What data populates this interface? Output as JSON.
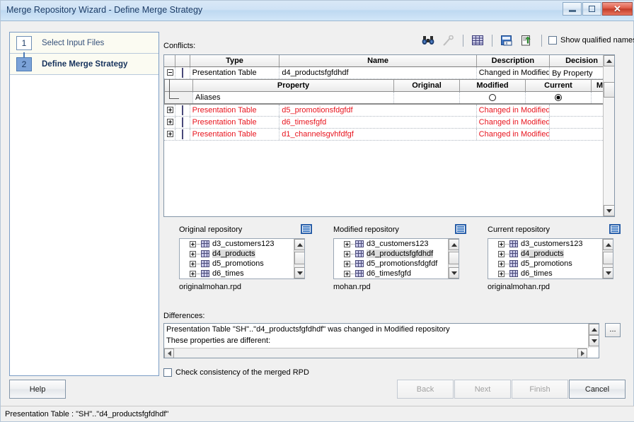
{
  "window": {
    "title": "Merge Repository Wizard - Define Merge Strategy",
    "minimize_label": "–",
    "restore_label": "□",
    "close_label": "✕"
  },
  "sidebar": {
    "steps": [
      {
        "num": "1",
        "label": "Select Input Files",
        "active": false
      },
      {
        "num": "2",
        "label": "Define Merge Strategy",
        "active": true
      }
    ]
  },
  "main": {
    "conflicts_label": "Conflicts:",
    "differences_label": "Differences:",
    "ellipsis_label": "..."
  },
  "toolbar": {
    "find_icon": "binoculars-icon",
    "wand_icon": "magic-wand-icon",
    "grid_icon": "grid-icon",
    "excel_icon": "export-excel-icon",
    "doc_icon": "import-document-icon",
    "show_qualified_names": "Show qualified names",
    "show_qualified_checked": false
  },
  "grid": {
    "headers": [
      "Type",
      "Name",
      "Description",
      "Decision"
    ],
    "rows": [
      {
        "expander": "minus",
        "type": "Presentation Table",
        "name": "d4_productsfgfdhdf",
        "description": "Changed in Modified",
        "decision": "By Property",
        "color": "black",
        "expanded": true
      },
      {
        "expander": "plus",
        "type": "Presentation Table",
        "name": "d5_promotionsfdgfdf",
        "description": "Changed in Modified",
        "decision": "",
        "color": "red",
        "expanded": false
      },
      {
        "expander": "plus",
        "type": "Presentation Table",
        "name": "d6_timesfgfd",
        "description": "Changed in Modified",
        "decision": "",
        "color": "red",
        "expanded": false
      },
      {
        "expander": "plus",
        "type": "Presentation Table",
        "name": "d1_channelsgvhfdfgf",
        "description": "Changed in Modified",
        "decision": "",
        "color": "red",
        "expanded": false
      }
    ],
    "subgrid": {
      "headers": [
        "Property",
        "Original",
        "Modified",
        "Current",
        "Merge Choices"
      ],
      "rows": [
        {
          "property": "Aliases",
          "original": "",
          "modified_selected": false,
          "current_selected": true,
          "merge_selected": false
        }
      ]
    }
  },
  "repositories": [
    {
      "title": "Original repository",
      "icon": "properties-icon",
      "file": "originalmohan.rpd",
      "nodes": [
        {
          "label": "d3_customers123",
          "selected": false
        },
        {
          "label": "d4_products",
          "selected": true
        },
        {
          "label": "d5_promotions",
          "selected": false
        },
        {
          "label": "d6_times",
          "selected": false
        }
      ]
    },
    {
      "title": "Modified repository",
      "icon": "properties-icon",
      "file": "mohan.rpd",
      "nodes": [
        {
          "label": "d3_customers123",
          "selected": false
        },
        {
          "label": "d4_productsfgfdhdf",
          "selected": true
        },
        {
          "label": "d5_promotionsfdgfdf",
          "selected": false
        },
        {
          "label": "d6_timesfgfd",
          "selected": false
        }
      ]
    },
    {
      "title": "Current repository",
      "icon": "properties-icon",
      "file": "originalmohan.rpd",
      "nodes": [
        {
          "label": "d3_customers123",
          "selected": false
        },
        {
          "label": "d4_products",
          "selected": true
        },
        {
          "label": "d5_promotions",
          "selected": false
        },
        {
          "label": "d6_times",
          "selected": false
        }
      ]
    }
  ],
  "differences": {
    "lines": [
      "Presentation Table \"SH\"..\"d4_productsfgfdhdf\" was changed in Modified repository",
      "These properties are different:"
    ]
  },
  "footer": {
    "consistency_label": "Check consistency of the merged RPD",
    "consistency_checked": false,
    "buttons": [
      {
        "label": "Help",
        "disabled": false
      },
      {
        "label": "Back",
        "disabled": true
      },
      {
        "label": "Next",
        "disabled": true
      },
      {
        "label": "Finish",
        "disabled": true
      },
      {
        "label": "Cancel",
        "disabled": false
      }
    ]
  },
  "statusbar": {
    "text": "Presentation Table : \"SH\"..\"d4_productsfgfdhdf\""
  }
}
